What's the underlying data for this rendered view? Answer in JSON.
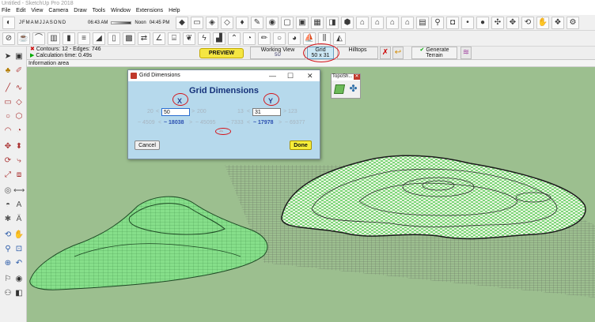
{
  "window": {
    "title": "Untitled - SketchUp Pro 2018"
  },
  "menu": [
    "File",
    "Edit",
    "View",
    "Camera",
    "Draw",
    "Tools",
    "Window",
    "Extensions",
    "Help"
  ],
  "shadows": {
    "months": [
      "J",
      "F",
      "M",
      "A",
      "M",
      "J",
      "J",
      "A",
      "S",
      "O",
      "N",
      "D"
    ],
    "time_start": "06:43 AM",
    "time_noon": "Noon",
    "time_end": "04:45 PM"
  },
  "toolbar1": {
    "icons": [
      "shadow-icon",
      "fog-icon",
      "box-icon",
      "tag-icon",
      "cube-icon",
      "bucket-icon",
      "erase-icon",
      "eye-icon",
      "xray-icon",
      "shaded-icon",
      "texture-icon",
      "mono-icon",
      "house-icon",
      "front-icon",
      "back-icon",
      "left-icon",
      "top-icon",
      "iso-icon",
      "magnify-icon",
      "section-icon",
      "component-icon",
      "dot-icon",
      "sphere-icon",
      "target-icon"
    ]
  },
  "toolbar2": {
    "icons": [
      "no-icon",
      "teapot-icon",
      "bridge-icon",
      "graph-icon",
      "tower-icon",
      "stack-icon",
      "ramp-icon",
      "frame-icon",
      "sandbox-icon",
      "flip-icon",
      "angle-icon",
      "stairs-icon",
      "leaf-icon",
      "bolt-icon",
      "wall-icon",
      "roof-icon",
      "tape-icon",
      "pencil-icon",
      "circle-icon",
      "pie-icon",
      "boat-icon",
      "bars-icon",
      "plane-icon"
    ]
  },
  "toposhaper": {
    "status_line1": "Contours: 12 - Edges: 746",
    "status_line2": "Calculation time: 0.49s",
    "preview_label": "PREVIEW",
    "working_view_label": "Working View",
    "working_view_badge": "5U",
    "grid_label": "Grid",
    "grid_value": "50 x 31",
    "hilltops_label": "Hilltops",
    "generate_label": "Generate",
    "terrain_label": "Terrain"
  },
  "info_area": "Information area",
  "dialog": {
    "title": "Grid Dimensions",
    "heading": "Grid Dimensions",
    "x_label": "X",
    "y_label": "Y",
    "x_min": "20",
    "x_value": "50",
    "x_max": "200",
    "y_min": "13",
    "y_value": "31",
    "y_max": "123",
    "x_size_min": "~ 4509",
    "x_size_value": "~ 18038",
    "x_size_max": "~ 45095",
    "y_size_min": "~ 7333",
    "y_size_value": "~ 17978",
    "y_size_max": "~ 69377",
    "arrow_low": "<",
    "arrow_high": ">",
    "lock_glyph": "⇔",
    "cancel_label": "Cancel",
    "done_label": "Done"
  },
  "topo_panel": {
    "title": "TopoSh..."
  },
  "colors": {
    "viewport": "#9cbf8f",
    "terrain": "#8ee08a",
    "dialog": "#b6d9ec",
    "highlight_yellow": "#f6ed3a",
    "annotation_red": "#d4141a"
  }
}
